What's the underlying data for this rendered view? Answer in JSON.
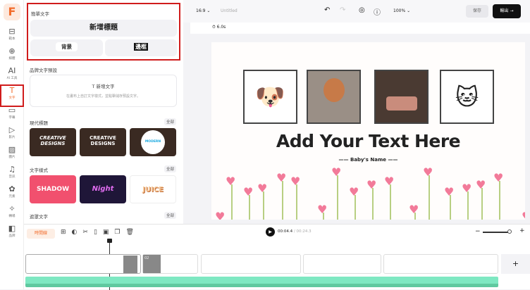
{
  "sidebar": {
    "logo": "F",
    "items": [
      {
        "label": "範本",
        "icon": "template-icon"
      },
      {
        "label": "媒體",
        "icon": "folder-upload-icon"
      },
      {
        "label": "AI 工具",
        "icon": "ai-icon"
      },
      {
        "label": "文字",
        "icon": "text-icon",
        "active": true
      },
      {
        "label": "字幕",
        "icon": "subtitle-icon"
      },
      {
        "label": "影片",
        "icon": "video-icon"
      },
      {
        "label": "圖片",
        "icon": "image-icon"
      },
      {
        "label": "音訊",
        "icon": "music-icon"
      },
      {
        "label": "元素",
        "icon": "shapes-icon"
      },
      {
        "label": "轉場",
        "icon": "transition-icon"
      },
      {
        "label": "品牌",
        "icon": "brand-icon"
      }
    ]
  },
  "panel": {
    "simple_text": {
      "title": "簡單文字",
      "add_heading": "新增標題",
      "background": "背景",
      "outline": "邊框"
    },
    "brand_presets": {
      "title": "品牌文字預設",
      "add_text": "新增文字",
      "hint": "在畫布上自訂文字樣式，並點擊儲存預設文字。"
    },
    "modern_titles": {
      "title": "現代標題",
      "all": "全部",
      "cards": [
        "CREATIVE DESIGNS",
        "CREATIVE DESIGNS",
        "MODERN"
      ]
    },
    "text_styles": {
      "title": "文字樣式",
      "all": "全部",
      "cards": [
        "SHADOW",
        "Night",
        "JUICE"
      ]
    },
    "mask_text": {
      "title": "遮罩文字",
      "all": "全部"
    }
  },
  "topbar": {
    "ratio": "16:9",
    "project_name": "Untitled",
    "zoom": "100%",
    "save": "保存",
    "export": "輸出"
  },
  "toolbar": {
    "duration": "6.0s"
  },
  "canvas": {
    "headline": "Add Your Text Here",
    "subtitle": "Baby's Name"
  },
  "timeline": {
    "timeline_button": "時間線",
    "current_time": "00:04.4",
    "total_time": "00:24.3",
    "clip_label": "02",
    "add": "+",
    "accent": "#f26d2d",
    "audio_color": "#7ee8c2"
  }
}
